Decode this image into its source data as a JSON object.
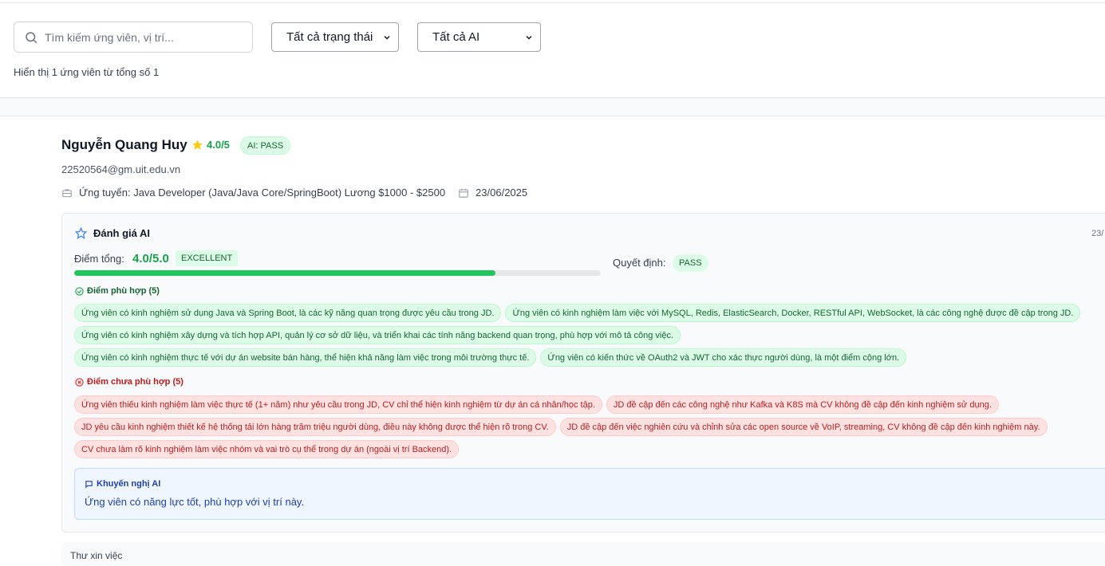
{
  "filters": {
    "search_placeholder": "Tìm kiếm ứng viên, vị trí...",
    "status_select": "Tất cả trạng thái",
    "ai_select": "Tất cả AI",
    "result_count": "Hiển thị 1 ứng viên từ tổng số 1"
  },
  "candidate": {
    "name": "Nguyễn Quang Huy",
    "rating": "4.0/5",
    "ai_badge": "AI: PASS",
    "email": "22520564@gm.uit.edu.vn",
    "applied_for": "Ứng tuyển: Java Developer (Java/Java Core/SpringBoot) Lương $1000 - $2500",
    "applied_date": "23/06/2025"
  },
  "ai_review": {
    "title": "Đánh giá AI",
    "date": "23/",
    "score_label": "Điểm tổng:",
    "score_value": "4.0/5.0",
    "score_level": "EXCELLENT",
    "score_fraction": 0.8,
    "decision_label": "Quyết định:",
    "decision_value": "PASS",
    "strengths_title": "Điểm phù hợp (5)",
    "strengths": [
      "Ứng viên có kinh nghiệm sử dụng Java và Spring Boot, là các kỹ năng quan trọng được yêu cầu trong JD.",
      "Ứng viên có kinh nghiệm làm việc với MySQL, Redis, ElasticSearch, Docker, RESTful API, WebSocket, là các công nghệ được đề cập trong JD.",
      "Ứng viên có kinh nghiệm xây dựng và tích hợp API, quản lý cơ sở dữ liệu, và triển khai các tính năng backend quan trọng, phù hợp với mô tả công việc.",
      "Ứng viên có kinh nghiệm thực tế với dự án website bán hàng, thể hiện khả năng làm việc trong môi trường thực tế.",
      "Ứng viên có kiến thức về OAuth2 và JWT cho xác thực người dùng, là một điểm cộng lớn."
    ],
    "weaknesses_title": "Điểm chưa phù hợp (5)",
    "weaknesses": [
      "Ứng viên thiếu kinh nghiệm làm việc thực tế (1+ năm) như yêu cầu trong JD, CV chỉ thể hiện kinh nghiệm từ dự án cá nhân/học tập.",
      "JD đề cập đến các công nghệ như Kafka và K8S mà CV không đề cập đến kinh nghiệm sử dụng.",
      "JD yêu cầu kinh nghiệm thiết kế hệ thống tải lớn hàng trăm triệu người dùng, điều này không được thể hiện rõ trong CV.",
      "JD đề cập đến việc nghiên cứu và chỉnh sửa các open source về VoIP, streaming, CV không đề cập đến kinh nghiệm này.",
      "CV chưa làm rõ kinh nghiệm làm việc nhóm và vai trò cụ thể trong dự án (ngoài vị trí Backend)."
    ],
    "recommendation_title": "Khuyến nghị AI",
    "recommendation_text": "Ứng viên có năng lực tốt, phù hợp với vị trí này."
  },
  "next_section": {
    "label": "Thư xin việc"
  },
  "colors": {
    "accent_green": "#16a34a",
    "danger_red": "#b91c1c",
    "info_blue": "#1e40af",
    "star_yellow": "#facc15"
  },
  "icons": [
    "search-icon",
    "chevron-down-icon",
    "star-icon",
    "briefcase-icon",
    "calendar-icon",
    "star-outline-icon",
    "check-circle-icon",
    "x-circle-icon",
    "message-icon"
  ]
}
